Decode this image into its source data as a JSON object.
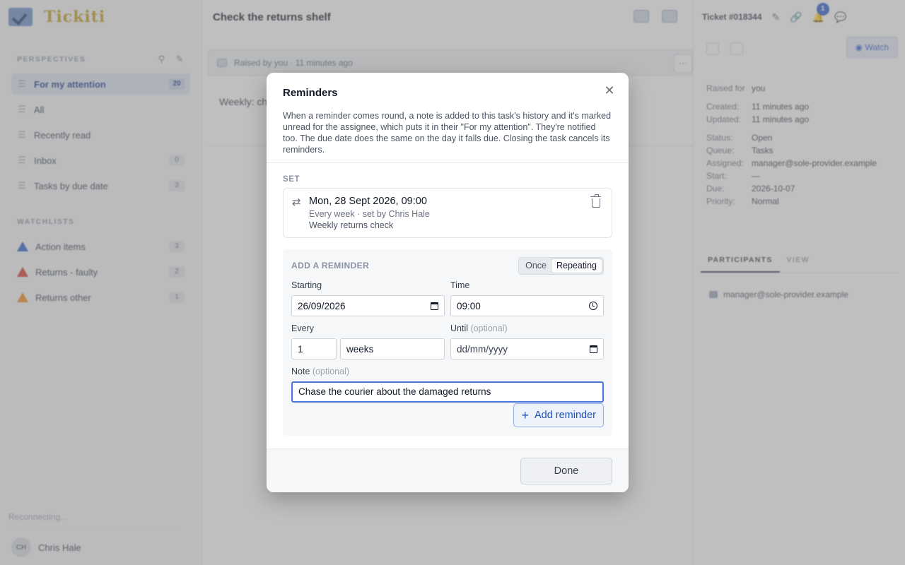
{
  "app": {
    "name": "Tickiti",
    "logo_icon": "check-logo-icon"
  },
  "sidebar": {
    "perspectives_title": "PERSPECTIVES",
    "perspectives": [
      {
        "label": "For my attention",
        "count": "20",
        "active": true
      },
      {
        "label": "All",
        "count": ""
      },
      {
        "label": "Recently read",
        "count": ""
      },
      {
        "label": "Inbox",
        "count": "0"
      },
      {
        "label": "Tasks by due date",
        "count": "3"
      }
    ],
    "watchlists_title": "WATCHLISTS",
    "watchlists": [
      {
        "label": "Action items",
        "count": "3",
        "color": "#2f5ecf"
      },
      {
        "label": "Returns - faulty",
        "count": "2",
        "color": "#d33a2c"
      },
      {
        "label": "Returns other",
        "count": "1",
        "color": "#f08a1a"
      }
    ],
    "status": "Reconnecting...",
    "user": {
      "initials": "CH",
      "name": "Chris Hale"
    }
  },
  "main": {
    "title": "Check the returns shelf",
    "raised": "Raised by you · 11 minutes ago",
    "more": "···",
    "body_preview": "Weekly: ch"
  },
  "right": {
    "ticket": "Ticket #018344",
    "notifications": "1",
    "watch_label": "Watch",
    "props": [
      {
        "k": "Raised for",
        "v": "you"
      },
      {
        "k": "Created:",
        "v": "11 minutes ago"
      },
      {
        "k": "Updated:",
        "v": "11 minutes ago"
      },
      {
        "k": "Status:",
        "v": "Open"
      },
      {
        "k": "Queue:",
        "v": "Tasks"
      },
      {
        "k": "Assigned:",
        "v": "manager@sole-provider.example"
      },
      {
        "k": "Start:",
        "v": "—"
      },
      {
        "k": "Due:",
        "v": "2026-10-07"
      },
      {
        "k": "Priority:",
        "v": "Normal"
      }
    ],
    "tabs": [
      "PARTICIPANTS",
      "VIEW"
    ],
    "participant": "manager@sole-provider.example"
  },
  "modal": {
    "title": "Reminders",
    "description": "When a reminder comes round, a note is added to this task's history and it's marked unread for the assignee, which puts it in their \"For my attention\". They're notified too. The due date does the same on the day it falls due. Closing the task cancels its reminders.",
    "set_label": "SET",
    "existing": {
      "date": "Mon, 28 Sept 2026, 09:00",
      "schedule": "Every week · set by Chris Hale",
      "note": "Weekly returns check"
    },
    "add": {
      "title": "ADD A REMINDER",
      "mode_once": "Once",
      "mode_repeating": "Repeating",
      "starting_label": "Starting",
      "starting_value": "26/09/2026",
      "time_label": "Time",
      "time_value": "09:00",
      "every_label": "Every",
      "every_value": "1",
      "unit_value": "weeks",
      "until_label": "Until",
      "until_optional": "(optional)",
      "until_placeholder": "dd/mm/yyyy",
      "note_label": "Note",
      "note_optional": "(optional)",
      "note_value": "Chase the courier about the damaged returns",
      "add_button": "Add reminder"
    },
    "done_button": "Done"
  }
}
